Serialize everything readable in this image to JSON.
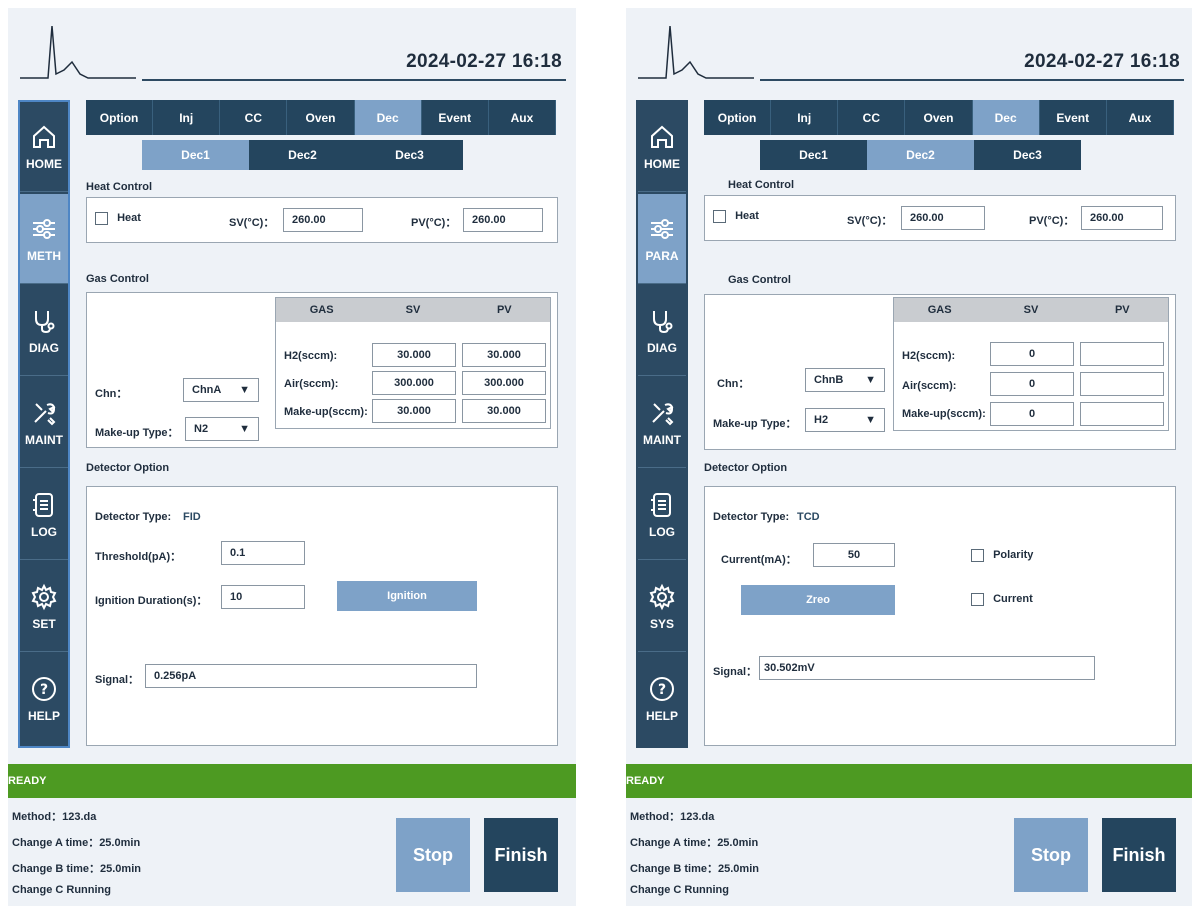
{
  "panels": [
    {
      "datetime": "2024-02-27  16:18",
      "sidebar": [
        {
          "label": "HOME",
          "icon": "home-icon"
        },
        {
          "label": "METH",
          "icon": "sliders-icon"
        },
        {
          "label": "DIAG",
          "icon": "stethoscope-icon"
        },
        {
          "label": "MAINT",
          "icon": "tools-icon"
        },
        {
          "label": "LOG",
          "icon": "log-book-icon"
        },
        {
          "label": "SET",
          "icon": "gear-icon"
        },
        {
          "label": "HELP",
          "icon": "help-icon"
        }
      ],
      "tabs": [
        "Option",
        "Inj",
        "CC",
        "Oven",
        "Dec",
        "Event",
        "Aux"
      ],
      "active_tab": "Dec",
      "subtabs": [
        "Dec1",
        "Dec2",
        "Dec3"
      ],
      "active_subtab": "Dec1",
      "heat_control": {
        "title": "Heat Control",
        "heat_label": "Heat",
        "sv_label": "SV(°C)：",
        "sv_value": "260.00",
        "pv_label": "PV(°C)：",
        "pv_value": "260.00"
      },
      "gas_control": {
        "title": "Gas Control",
        "headers": [
          "GAS",
          "SV",
          "PV"
        ],
        "rows": [
          {
            "label": "H2(sccm):",
            "sv": "30.000",
            "pv": "30.000"
          },
          {
            "label": "Air(sccm):",
            "sv": "300.000",
            "pv": "300.000"
          },
          {
            "label": "Make-up(sccm):",
            "sv": "30.000",
            "pv": "30.000"
          }
        ],
        "chn_label": "Chn：",
        "chn_value": "ChnA",
        "makeup_label": "Make-up Type：",
        "makeup_value": "N2"
      },
      "detector": {
        "title": "Detector Option",
        "type_label": "Detector Type:",
        "type_value": "FID",
        "threshold_label": "Threshold(pA)：",
        "threshold_value": "0.1",
        "ignition_label": "Ignition Duration(s)：",
        "ignition_value": "10",
        "ignition_button": "Ignition",
        "signal_label": "Signal：",
        "signal_value": "0.256pA"
      },
      "status": "READY",
      "info": {
        "method": "Method：123.da",
        "change_a": "Change A time：25.0min",
        "change_b": "Change B time：25.0min",
        "change_c": "Change C Running"
      },
      "stop_label": "Stop",
      "finish_label": "Finish"
    },
    {
      "datetime": "2024-02-27  16:18",
      "sidebar": [
        {
          "label": "HOME",
          "icon": "home-icon"
        },
        {
          "label": "PARA",
          "icon": "sliders-icon"
        },
        {
          "label": "DIAG",
          "icon": "stethoscope-icon"
        },
        {
          "label": "MAINT",
          "icon": "tools-icon"
        },
        {
          "label": "LOG",
          "icon": "log-book-icon"
        },
        {
          "label": "SYS",
          "icon": "gear-icon"
        },
        {
          "label": "HELP",
          "icon": "help-icon"
        }
      ],
      "tabs": [
        "Option",
        "Inj",
        "CC",
        "Oven",
        "Dec",
        "Event",
        "Aux"
      ],
      "active_tab": "Dec",
      "subtabs": [
        "Dec1",
        "Dec2",
        "Dec3"
      ],
      "active_subtab": "Dec2",
      "heat_control": {
        "title": "Heat Control",
        "heat_label": "Heat",
        "sv_label": "SV(°C)：",
        "sv_value": "260.00",
        "pv_label": "PV(°C)：",
        "pv_value": "260.00"
      },
      "gas_control": {
        "title": "Gas Control",
        "headers": [
          "GAS",
          "SV",
          "PV"
        ],
        "rows": [
          {
            "label": "H2(sccm):",
            "sv": "0",
            "pv": ""
          },
          {
            "label": "Air(sccm):",
            "sv": "0",
            "pv": ""
          },
          {
            "label": "Make-up(sccm):",
            "sv": "0",
            "pv": ""
          }
        ],
        "chn_label": "Chn：",
        "chn_value": "ChnB",
        "makeup_label": "Make-up Type：",
        "makeup_value": "H2"
      },
      "detector": {
        "title": "Detector Option",
        "type_label": "Detector Type:",
        "type_value": "TCD",
        "current_label": "Current(mA)：",
        "current_value": "50",
        "polarity_label": "Polarity",
        "current_check_label": "Current",
        "zero_button": "Zreo",
        "signal_label": "Signal：",
        "signal_value": "30.502mV"
      },
      "status": "READY",
      "info": {
        "method": "Method：123.da",
        "change_a": "Change A time：25.0min",
        "change_b": "Change B time：25.0min",
        "change_c": "Change C Running"
      },
      "stop_label": "Stop",
      "finish_label": "Finish"
    }
  ],
  "colors": {
    "navy": "#24455e",
    "accent_blue": "#7ea2c8",
    "ready_green": "#4d9a22",
    "panel_bg": "#eef2f7"
  }
}
